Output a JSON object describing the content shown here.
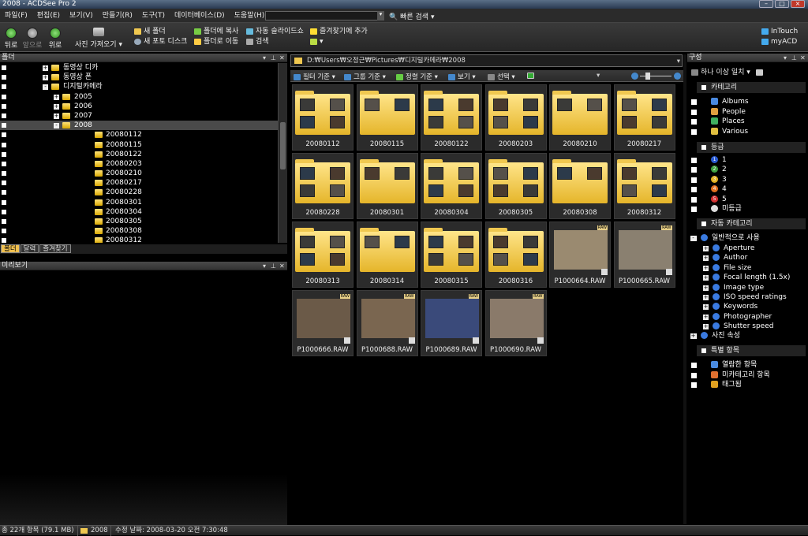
{
  "window": {
    "title": "2008 - ACDSee Pro 2"
  },
  "menu": [
    "파일(F)",
    "편집(E)",
    "보기(V)",
    "만들기(R)",
    "도구(T)",
    "데이터베이스(D)",
    "도움말(H)"
  ],
  "quick_search": "빠른 검색",
  "toolbar": {
    "back": "뒤로",
    "forward": "앞으로",
    "up": "위로",
    "acquire": "사진 가져오기",
    "new_folder": "새 폴더",
    "new_photodisc": "새 포토 디스크",
    "copy_to_folder": "폴더에 복사",
    "move_to_folder": "폴더로 이동",
    "auto_slideshow": "자동 슬라이드쇼",
    "search": "검색",
    "add_favorites": "즐겨찾기에 추가",
    "intouch": "InTouch",
    "myacd": "myACD"
  },
  "panels": {
    "folders": "폴더",
    "preview": "미리보기",
    "organize": "구성"
  },
  "tree": [
    {
      "label": "동영상 디카",
      "depth": 0,
      "exp": "+"
    },
    {
      "label": "동영상 폰",
      "depth": 0,
      "exp": "+"
    },
    {
      "label": "디지털카메라",
      "depth": 0,
      "exp": "-"
    },
    {
      "label": "2005",
      "depth": 1,
      "exp": "+"
    },
    {
      "label": "2006",
      "depth": 1,
      "exp": "+"
    },
    {
      "label": "2007",
      "depth": 1,
      "exp": "+"
    },
    {
      "label": "2008",
      "depth": 1,
      "exp": "-",
      "sel": true
    },
    {
      "label": "20080112",
      "depth": 2
    },
    {
      "label": "20080115",
      "depth": 2
    },
    {
      "label": "20080122",
      "depth": 2
    },
    {
      "label": "20080203",
      "depth": 2
    },
    {
      "label": "20080210",
      "depth": 2
    },
    {
      "label": "20080217",
      "depth": 2
    },
    {
      "label": "20080228",
      "depth": 2
    },
    {
      "label": "20080301",
      "depth": 2
    },
    {
      "label": "20080304",
      "depth": 2
    },
    {
      "label": "20080305",
      "depth": 2
    },
    {
      "label": "20080308",
      "depth": 2
    },
    {
      "label": "20080312",
      "depth": 2
    }
  ],
  "tabs": [
    "폴더",
    "달력",
    "즐겨찾기"
  ],
  "path": "D:₩Users₩오정근₩Pictures₩디지털카메라₩2008",
  "filterbar": {
    "filter": "필터 기준",
    "group": "그룹 기준",
    "sort": "정렬 기준",
    "view": "보기",
    "select": "선택"
  },
  "items": [
    {
      "name": "20080112",
      "type": "folder"
    },
    {
      "name": "20080115",
      "type": "folder"
    },
    {
      "name": "20080122",
      "type": "folder"
    },
    {
      "name": "20080203",
      "type": "folder"
    },
    {
      "name": "20080210",
      "type": "folder"
    },
    {
      "name": "20080217",
      "type": "folder"
    },
    {
      "name": "20080228",
      "type": "folder"
    },
    {
      "name": "20080301",
      "type": "folder"
    },
    {
      "name": "20080304",
      "type": "folder"
    },
    {
      "name": "20080305",
      "type": "folder"
    },
    {
      "name": "20080308",
      "type": "folder"
    },
    {
      "name": "20080312",
      "type": "folder"
    },
    {
      "name": "20080313",
      "type": "folder"
    },
    {
      "name": "20080314",
      "type": "folder"
    },
    {
      "name": "20080315",
      "type": "folder"
    },
    {
      "name": "20080316",
      "type": "folder"
    },
    {
      "name": "P1000664.RAW",
      "type": "photo",
      "badge": "RAW"
    },
    {
      "name": "P1000665.RAW",
      "type": "photo",
      "badge": "RAW"
    },
    {
      "name": "P1000666.RAW",
      "type": "photo",
      "badge": "RAW"
    },
    {
      "name": "P1000688.RAW",
      "type": "photo",
      "badge": "RAW"
    },
    {
      "name": "P1000689.RAW",
      "type": "photo",
      "badge": "RAW"
    },
    {
      "name": "P1000690.RAW",
      "type": "photo",
      "badge": "RAW"
    }
  ],
  "organize": {
    "match": "하나 이상 일치",
    "categories_title": "카테고리",
    "categories": [
      "Albums",
      "People",
      "Places",
      "Various"
    ],
    "ratings_title": "등급",
    "ratings": [
      "1",
      "2",
      "3",
      "4",
      "5",
      "미등급"
    ],
    "auto_title": "자동 카테고리",
    "auto_group": "일반적으로 사용",
    "auto_items": [
      "Aperture",
      "Author",
      "File size",
      "Focal length (1.5x)",
      "Image type",
      "ISO speed ratings",
      "Keywords",
      "Photographer",
      "Shutter speed"
    ],
    "photo_props": "사진 속성",
    "special_title": "특별 항목",
    "special": [
      "열람한 항목",
      "미카테고리 항목",
      "태그됨"
    ]
  },
  "status": {
    "total": "총 22개 항목 (79.1 MB)",
    "folder": "2008",
    "modified": "수정 날짜: 2008-03-20 오전 7:30:48"
  },
  "colors": {
    "folder": "#f0c850",
    "accent": "#f0c050"
  }
}
